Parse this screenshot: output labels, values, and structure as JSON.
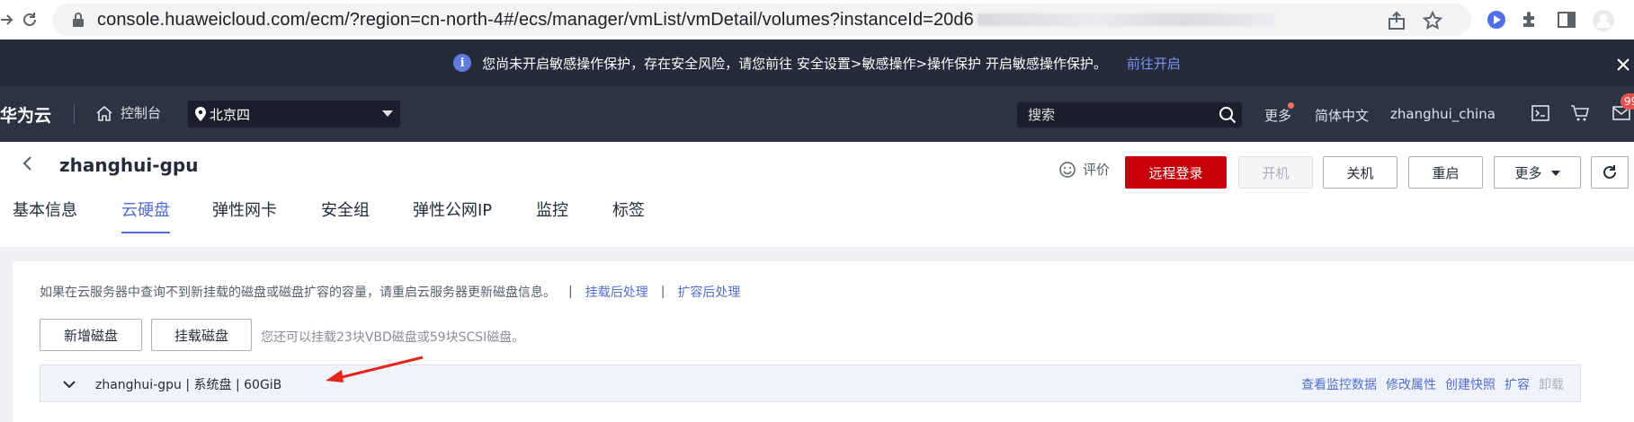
{
  "browser": {
    "url_visible": "console.huaweicloud.com/ecm/?region=cn-north-4#/ecs/manager/vmList/vmDetail/volumes?instanceId=20d6"
  },
  "banner": {
    "text": "您尚未开启敏感操作保护，存在安全风险，请您前往 安全设置>敏感操作>操作保护 开启敏感操作保护。",
    "link": "前往开启"
  },
  "header": {
    "brand": "华为云",
    "console": "控制台",
    "region": "北京四",
    "search_placeholder": "搜索",
    "more": "更多",
    "language": "简体中文",
    "user": "zhanghui_china",
    "badge": "99"
  },
  "page": {
    "title": "zhanghui-gpu",
    "rate": "评价",
    "actions": {
      "remote_login": "远程登录",
      "start": "开机",
      "shutdown": "关机",
      "restart": "重启",
      "more": "更多"
    },
    "tabs": [
      "基本信息",
      "云硬盘",
      "弹性网卡",
      "安全组",
      "弹性公网IP",
      "监控",
      "标签"
    ],
    "active_tab": "云硬盘"
  },
  "volumes": {
    "tip": "如果在云服务器中查询不到新挂载的磁盘或磁盘扩容的容量，请重启云服务器更新磁盘信息。",
    "tip_link_1": "挂载后处理",
    "tip_link_2": "扩容后处理",
    "add_disk": "新增磁盘",
    "attach_disk": "挂载磁盘",
    "quota": "您还可以挂载23块VBD磁盘或59块SCSI磁盘。",
    "disk": {
      "label": "zhanghui-gpu | 系统盘 | 60GiB",
      "ops": [
        "查看监控数据",
        "修改属性",
        "创建快照",
        "扩容"
      ],
      "ops_disabled": "卸载"
    }
  },
  "colors": {
    "brand_red": "#c7000b",
    "link_blue": "#526ecc",
    "header_bg": "#2c3444",
    "banner_bg": "#252b3a"
  }
}
